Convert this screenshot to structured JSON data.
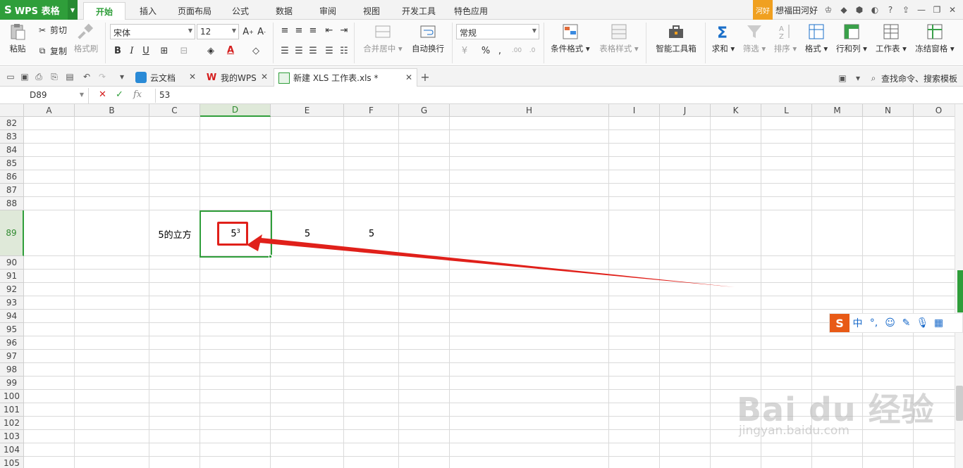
{
  "app": {
    "logo": "WPS 表格",
    "accent": "#2f9e3a"
  },
  "menu_tabs": [
    "开始",
    "插入",
    "页面布局",
    "公式",
    "数据",
    "审阅",
    "视图",
    "开发工具",
    "特色应用"
  ],
  "user": {
    "badge": "河好",
    "name": "想福田河好"
  },
  "ribbon": {
    "paste": "粘贴",
    "cut": "剪切",
    "copy": "复制",
    "format_painter": "格式刷",
    "font_name": "宋体",
    "font_size": "12",
    "merge_center": "合并居中",
    "wrap_text": "自动换行",
    "number_format": "常规",
    "conditional_format": "条件格式",
    "table_style": "表格样式",
    "smart_toolbox": "智能工具箱",
    "sum": "求和",
    "filter": "筛选",
    "sort": "排序",
    "format": "格式",
    "row_col": "行和列",
    "worksheet": "工作表",
    "freeze": "冻结窗格",
    "bold": "B",
    "italic": "I",
    "underline": "U",
    "percent": "%"
  },
  "doc_tabs": {
    "cloud": "云文档",
    "mywps": "我的WPS",
    "active": "新建 XLS 工作表.xls *",
    "search": "查找命令、搜索模板"
  },
  "formula_bar": {
    "name_box": "D89",
    "value": "53",
    "fx": "fx"
  },
  "columns": [
    "A",
    "B",
    "C",
    "D",
    "E",
    "F",
    "G",
    "H",
    "I",
    "J",
    "K",
    "L",
    "M",
    "N",
    "O"
  ],
  "rows": [
    "82",
    "83",
    "84",
    "85",
    "86",
    "87",
    "88",
    "89",
    "90",
    "91",
    "92",
    "93",
    "94",
    "95",
    "96",
    "97",
    "98",
    "99",
    "100",
    "101",
    "102",
    "103",
    "104",
    "105"
  ],
  "cells": {
    "c89": "5的立方",
    "d89_base": "5",
    "d89_sup": "3",
    "e89": "5",
    "f89": "5"
  },
  "watermark": {
    "line1": "Bai du 经验",
    "line2": "jingyan.baidu.com"
  },
  "ime": {
    "logo": "S",
    "lang": "中",
    "punct": "°,"
  }
}
